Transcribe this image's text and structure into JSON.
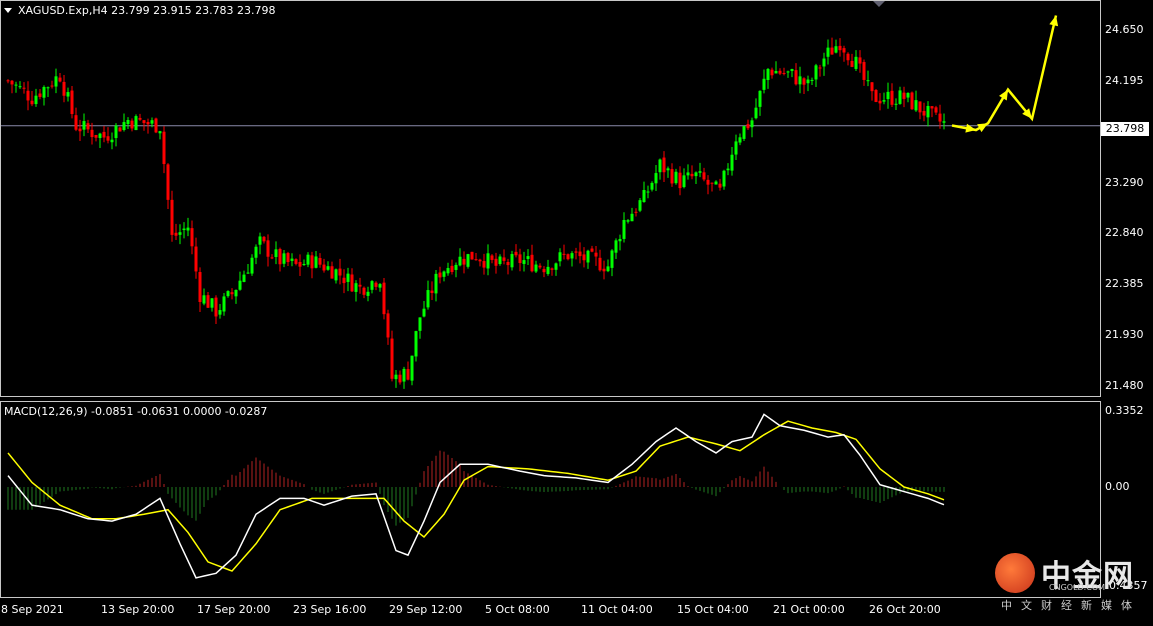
{
  "header": {
    "symbol_line": "XAGUSD.Exp,H4  23.799 23.915 23.783 23.798"
  },
  "macd_header": {
    "text": "MACD(12,26,9) -0.0851 -0.0631 0.0000 -0.0287"
  },
  "current_price_label": "23.798",
  "watermark": {
    "brand": "中金网",
    "domain": "CNGOLD.COM",
    "subtitle": "中文财经新媒体"
  },
  "colors": {
    "background": "#000000",
    "bull": "#00ff00",
    "bear": "#ff0000",
    "macd_line": "#ffffff",
    "signal_line": "#ffff00",
    "hist_pos": "#b22222",
    "hist_neg": "#1f7a1f",
    "projection": "#ffff00",
    "current_price_line": "#8a8aaa"
  },
  "chart_data": [
    {
      "type": "candlestick",
      "panel": "price",
      "symbol": "XAGUSD.Exp",
      "timeframe": "H4",
      "ylim": [
        21.4,
        24.9
      ],
      "ytick_labels": [
        "24.650",
        "24.195",
        "23.798",
        "23.290",
        "22.840",
        "22.385",
        "21.930",
        "21.480"
      ],
      "ytick_values": [
        24.65,
        24.195,
        23.798,
        23.29,
        22.84,
        22.385,
        21.93,
        21.48
      ],
      "current_price": 23.798,
      "x_labels": [
        "8 Sep 2021",
        "13 Sep 20:00",
        "17 Sep 20:00",
        "23 Sep 16:00",
        "29 Sep 12:00",
        "5 Oct 08:00",
        "11 Oct 04:00",
        "15 Oct 04:00",
        "21 Oct 00:00",
        "26 Oct 20:00"
      ],
      "x_label_bar_index": [
        0,
        24,
        48,
        72,
        96,
        120,
        144,
        168,
        192,
        216
      ],
      "bar_count": 235,
      "price_path_anchors": [
        [
          0,
          24.2
        ],
        [
          6,
          24.05
        ],
        [
          13,
          24.25
        ],
        [
          17,
          23.8
        ],
        [
          24,
          23.7
        ],
        [
          30,
          23.85
        ],
        [
          38,
          23.8
        ],
        [
          41,
          22.8
        ],
        [
          45,
          22.9
        ],
        [
          48,
          22.3
        ],
        [
          52,
          22.15
        ],
        [
          56,
          22.3
        ],
        [
          60,
          22.55
        ],
        [
          63,
          22.75
        ],
        [
          68,
          22.6
        ],
        [
          72,
          22.55
        ],
        [
          76,
          22.6
        ],
        [
          82,
          22.5
        ],
        [
          88,
          22.35
        ],
        [
          93,
          22.45
        ],
        [
          96,
          21.55
        ],
        [
          100,
          21.6
        ],
        [
          103,
          22.1
        ],
        [
          108,
          22.5
        ],
        [
          112,
          22.6
        ],
        [
          117,
          22.65
        ],
        [
          122,
          22.55
        ],
        [
          128,
          22.6
        ],
        [
          134,
          22.55
        ],
        [
          140,
          22.65
        ],
        [
          146,
          22.6
        ],
        [
          150,
          22.55
        ],
        [
          154,
          22.95
        ],
        [
          159,
          23.15
        ],
        [
          163,
          23.45
        ],
        [
          168,
          23.3
        ],
        [
          172,
          23.35
        ],
        [
          178,
          23.2
        ],
        [
          182,
          23.7
        ],
        [
          186,
          23.85
        ],
        [
          190,
          24.3
        ],
        [
          196,
          24.25
        ],
        [
          200,
          24.15
        ],
        [
          204,
          24.4
        ],
        [
          208,
          24.55
        ],
        [
          212,
          24.35
        ],
        [
          216,
          24.05
        ],
        [
          220,
          24.05
        ],
        [
          224,
          24.05
        ],
        [
          228,
          23.95
        ],
        [
          232,
          23.85
        ],
        [
          235,
          23.8
        ]
      ],
      "projection": [
        [
          236,
          23.8
        ],
        [
          242,
          23.76
        ],
        [
          245,
          23.82
        ],
        [
          250,
          24.12
        ],
        [
          256,
          23.86
        ],
        [
          262,
          24.78
        ]
      ]
    },
    {
      "type": "macd",
      "panel": "indicator",
      "params": "12,26,9",
      "macd_value": -0.0851,
      "signal_value": -0.0631,
      "ylim": [
        -0.48,
        0.37
      ],
      "ytick_labels": [
        "0.3352",
        "0.00",
        "-0.4357"
      ],
      "ytick_values": [
        0.3352,
        0.0,
        -0.4357
      ],
      "macd_anchors": [
        [
          0,
          0.05
        ],
        [
          6,
          -0.08
        ],
        [
          13,
          -0.1
        ],
        [
          20,
          -0.14
        ],
        [
          26,
          -0.15
        ],
        [
          32,
          -0.12
        ],
        [
          38,
          -0.05
        ],
        [
          43,
          -0.25
        ],
        [
          47,
          -0.4
        ],
        [
          52,
          -0.38
        ],
        [
          57,
          -0.3
        ],
        [
          62,
          -0.12
        ],
        [
          68,
          -0.05
        ],
        [
          74,
          -0.05
        ],
        [
          79,
          -0.08
        ],
        [
          86,
          -0.04
        ],
        [
          92,
          -0.03
        ],
        [
          97,
          -0.28
        ],
        [
          100,
          -0.3
        ],
        [
          104,
          -0.15
        ],
        [
          108,
          0.02
        ],
        [
          113,
          0.1
        ],
        [
          120,
          0.1
        ],
        [
          128,
          0.07
        ],
        [
          134,
          0.05
        ],
        [
          142,
          0.04
        ],
        [
          150,
          0.02
        ],
        [
          156,
          0.1
        ],
        [
          162,
          0.2
        ],
        [
          167,
          0.26
        ],
        [
          172,
          0.2
        ],
        [
          177,
          0.15
        ],
        [
          181,
          0.2
        ],
        [
          186,
          0.22
        ],
        [
          189,
          0.32
        ],
        [
          193,
          0.27
        ],
        [
          199,
          0.25
        ],
        [
          205,
          0.22
        ],
        [
          209,
          0.23
        ],
        [
          213,
          0.14
        ],
        [
          218,
          0.01
        ],
        [
          224,
          -0.02
        ],
        [
          230,
          -0.05
        ],
        [
          235,
          -0.0851
        ]
      ],
      "signal_anchors": [
        [
          0,
          0.15
        ],
        [
          6,
          0.02
        ],
        [
          13,
          -0.08
        ],
        [
          21,
          -0.14
        ],
        [
          27,
          -0.14
        ],
        [
          34,
          -0.12
        ],
        [
          40,
          -0.1
        ],
        [
          45,
          -0.2
        ],
        [
          50,
          -0.33
        ],
        [
          56,
          -0.37
        ],
        [
          62,
          -0.25
        ],
        [
          68,
          -0.1
        ],
        [
          76,
          -0.05
        ],
        [
          86,
          -0.05
        ],
        [
          94,
          -0.05
        ],
        [
          99,
          -0.15
        ],
        [
          104,
          -0.22
        ],
        [
          109,
          -0.12
        ],
        [
          114,
          0.03
        ],
        [
          120,
          0.09
        ],
        [
          130,
          0.08
        ],
        [
          140,
          0.06
        ],
        [
          150,
          0.03
        ],
        [
          157,
          0.07
        ],
        [
          163,
          0.18
        ],
        [
          170,
          0.22
        ],
        [
          177,
          0.19
        ],
        [
          183,
          0.16
        ],
        [
          189,
          0.23
        ],
        [
          195,
          0.29
        ],
        [
          201,
          0.26
        ],
        [
          207,
          0.24
        ],
        [
          212,
          0.21
        ],
        [
          218,
          0.08
        ],
        [
          224,
          0.0
        ],
        [
          230,
          -0.03
        ],
        [
          235,
          -0.0631
        ]
      ]
    }
  ]
}
